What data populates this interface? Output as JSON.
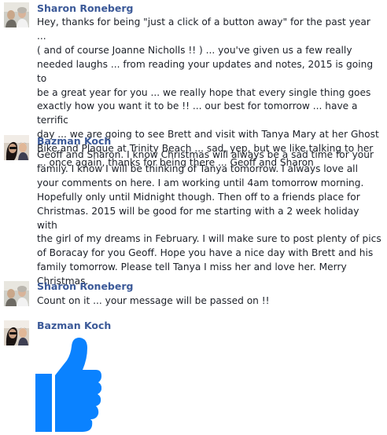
{
  "theme": {
    "name_color": "#3b5998",
    "text_color": "#1d2129",
    "like_color": "#0a82ff"
  },
  "messages": [
    {
      "author": "Sharon Roneberg",
      "avatar": "sharon-avatar",
      "text": "Hey, thanks for being \"just a click of a button away\" for the past year ...\n( and of course Joanne Nicholls !! ) ... you've given us a few really\nneeded laughs ... from reading your updates and notes, 2015 is going to\nbe a great year for you ... we really hope that every single thing goes\nexactly how you want it to be !! ... our best for tomorrow ... have a terrific\nday ... we are going to see Brett and visit with Tanya Mary at her Ghost\nBike and Plaque at Trinity Beach ... sad, yep, but we like talking to her\n... once again, thanks for being there ... Geoff and Sharon"
    },
    {
      "author": "Bazman Koch",
      "avatar": "bazman-avatar",
      "text": "Geoff and Sharon.  I know Christmas will always be a sad time for your\nfamily.  I know I will be thinking of Tanya tomorrow.  I always love all\nyour comments on here.  I am working until 4am tomorrow morning.\nHopefully only until Midnight though.  Then off to a friends place for\nChristmas.  2015 will be good for me starting with a 2 week holiday with\nthe girl of my dreams in February.  I will make sure to post plenty of pics\nof Boracay for you Geoff.  Hope you have a nice day with Brett and his\nfamily tomorrow.  Please tell Tanya I miss her and love her.  Merry\nChristmas."
    },
    {
      "author": "Sharon Roneberg",
      "avatar": "sharon-avatar",
      "text": "Count on it ... your message will be passed on !!"
    },
    {
      "author": "Bazman Koch",
      "avatar": "bazman-avatar",
      "sticker": "thumbs-up-sticker"
    }
  ]
}
